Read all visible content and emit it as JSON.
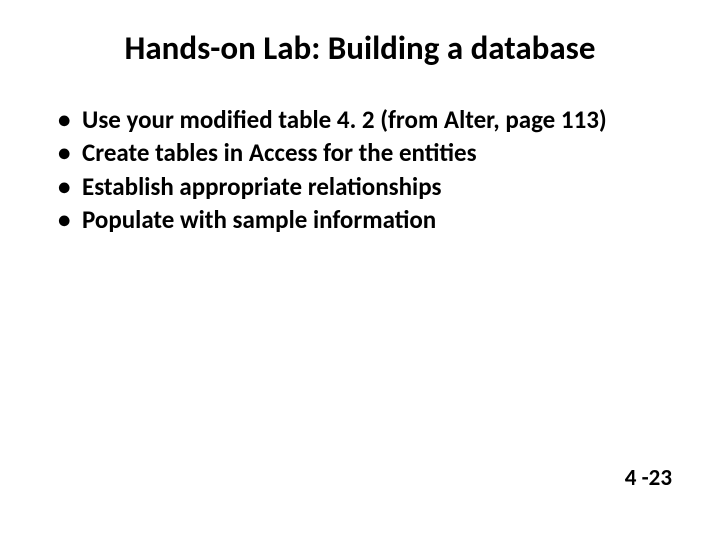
{
  "slide": {
    "title": "Hands-on Lab:  Building a database",
    "bullets": [
      "Use your modified table 4. 2 (from Alter, page 113)",
      "Create tables in Access for the entities",
      "Establish appropriate relationships",
      "Populate with sample information"
    ],
    "page_number": "4 -23"
  }
}
